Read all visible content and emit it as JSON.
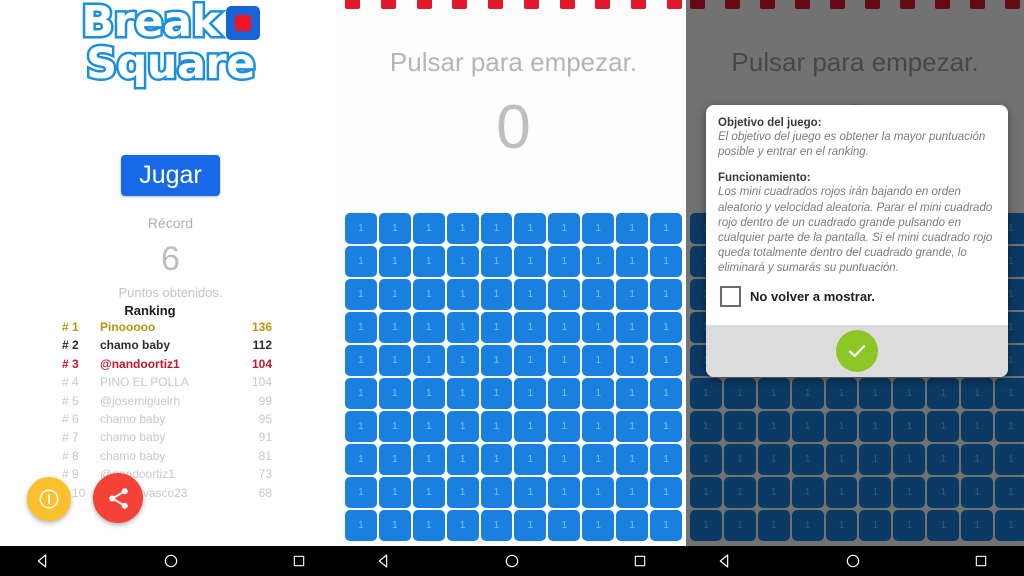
{
  "app": {
    "logo_line1": "Break",
    "logo_line2": "Square",
    "logo_square_icon": "red-square-icon"
  },
  "menu": {
    "play_label": "Jugar",
    "record_label": "Récord",
    "record_value": "6",
    "record_sub": "Puntos obtenidos.",
    "ranking_title": "Ranking",
    "ranking": [
      {
        "pos": "# 1",
        "name": "Pinooooo",
        "score": "136",
        "style": "r-gold"
      },
      {
        "pos": "# 2",
        "name": "chamo baby",
        "score": "112",
        "style": "r-dark"
      },
      {
        "pos": "# 3",
        "name": "@nandoortiz1",
        "score": "104",
        "style": "r-red"
      },
      {
        "pos": "# 4",
        "name": "PINO EL POLLA",
        "score": "104",
        "style": "r-grey"
      },
      {
        "pos": "# 5",
        "name": "@josemiguelrh",
        "score": "99",
        "style": "r-grey"
      },
      {
        "pos": "# 6",
        "name": "chamo baby",
        "score": "95",
        "style": "r-grey"
      },
      {
        "pos": "# 7",
        "name": "chamo baby",
        "score": "91",
        "style": "r-grey"
      },
      {
        "pos": "# 8",
        "name": "chamo baby",
        "score": "81",
        "style": "r-grey"
      },
      {
        "pos": "# 9",
        "name": "@nandoortiz1",
        "score": "73",
        "style": "r-grey"
      },
      {
        "pos": "# 10",
        "name": "@rubenvasco23",
        "score": "68",
        "style": "r-grey"
      }
    ],
    "fab_info_icon": "info-icon",
    "fab_share_icon": "share-icon",
    "colors": {
      "play_button": "#1769e8",
      "rank_gold": "#b8960e",
      "rank_red": "#c2182b",
      "rank_grey": "#c9c9c9",
      "fab_info": "#fbc02d",
      "fab_share": "#f44336"
    }
  },
  "game": {
    "tap_hint": "Pulsar para empezar.",
    "score": "0",
    "grid_rows": 10,
    "grid_cols": 10,
    "cell_label": "1",
    "mini_squares": 10,
    "colors": {
      "cell": "#1a80e0",
      "mini_square": "#e1182c",
      "hint_text": "#b5b5b5"
    }
  },
  "dialog": {
    "heading_1": "Objetivo del juego:",
    "paragraph_1": "El objetivo del juego es obtener la mayor puntuación posible y entrar en el ranking.",
    "heading_2": "Funcionamiento:",
    "paragraph_2": "Los mini cuadrados rojos irán bajando en orden aleatorio y velocidad aleatoria. Parar el mini cuadrado rojo dentro de un cuadrado grande pulsando en cualquier parte de la pantalla. Si el mini cuadrado rojo queda totalmente dentro del cuadrado grande, lo eliminará y sumarás su puntuación.",
    "checkbox_label": "No volver a mostrar.",
    "checkbox_checked": false,
    "ok_icon": "checkmark-icon",
    "colors": {
      "ok_button": "#8cc627",
      "footer": "#dcdcdc"
    }
  },
  "navbar": {
    "back_icon": "back-triangle-icon",
    "home_icon": "home-circle-icon",
    "recents_icon": "recents-square-icon"
  }
}
